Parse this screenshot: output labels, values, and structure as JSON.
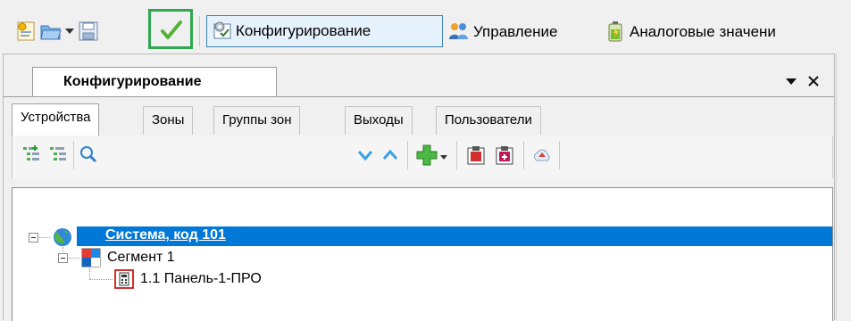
{
  "toolbar": {
    "config_label": "Конфигурирование",
    "manage_label": "Управление",
    "analog_label": "Аналоговые значени",
    "colors": {
      "highlight_border": "#2fa84f",
      "check": "#55b235"
    }
  },
  "panel": {
    "title": "Конфигурирование",
    "subtabs": [
      "Устройства",
      "Зоны",
      "Группы зон",
      "Выходы",
      "Пользователи"
    ]
  },
  "tree": {
    "root": "Система, код 101",
    "child": "Сегмент 1",
    "leaf": "1.1 Панель-1-ПРО",
    "colors": {
      "selection": "#0078d7"
    }
  }
}
